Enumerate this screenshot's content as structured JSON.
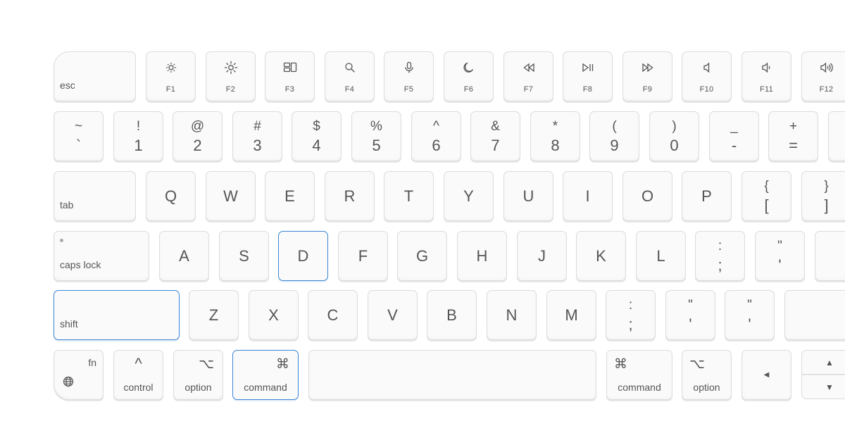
{
  "function_row": [
    {
      "id": "f1",
      "label": "F1",
      "icon": "brightness-low-icon"
    },
    {
      "id": "f2",
      "label": "F2",
      "icon": "brightness-high-icon"
    },
    {
      "id": "f3",
      "label": "F3",
      "icon": "mission-control-icon"
    },
    {
      "id": "f4",
      "label": "F4",
      "icon": "search-icon"
    },
    {
      "id": "f5",
      "label": "F5",
      "icon": "microphone-icon"
    },
    {
      "id": "f6",
      "label": "F6",
      "icon": "moon-icon"
    },
    {
      "id": "f7",
      "label": "F7",
      "icon": "rewind-icon"
    },
    {
      "id": "f8",
      "label": "F8",
      "icon": "play-pause-icon"
    },
    {
      "id": "f9",
      "label": "F9",
      "icon": "fast-forward-icon"
    },
    {
      "id": "f10",
      "label": "F10",
      "icon": "mute-icon"
    },
    {
      "id": "f11",
      "label": "F11",
      "icon": "volume-down-icon"
    },
    {
      "id": "f12",
      "label": "F12",
      "icon": "volume-up-icon"
    }
  ],
  "keys": {
    "esc": "esc",
    "tab": "tab",
    "caps_lock": "caps lock",
    "shift": "shift",
    "fn": "fn",
    "control": "control",
    "control_symbol": "^",
    "option": "option",
    "option_symbol": "⌥",
    "command": "command",
    "command_symbol": "⌘"
  },
  "number_row": [
    {
      "top": "~",
      "bottom": "`"
    },
    {
      "top": "!",
      "bottom": "1"
    },
    {
      "top": "@",
      "bottom": "2"
    },
    {
      "top": "#",
      "bottom": "3"
    },
    {
      "top": "$",
      "bottom": "4"
    },
    {
      "top": "%",
      "bottom": "5"
    },
    {
      "top": "^",
      "bottom": "6"
    },
    {
      "top": "&",
      "bottom": "7"
    },
    {
      "top": "*",
      "bottom": "8"
    },
    {
      "top": "(",
      "bottom": "9"
    },
    {
      "top": ")",
      "bottom": "0"
    },
    {
      "top": "_",
      "bottom": "-"
    },
    {
      "top": "+",
      "bottom": "="
    }
  ],
  "qwerty_row": [
    "Q",
    "W",
    "E",
    "R",
    "T",
    "Y",
    "U",
    "I",
    "O",
    "P"
  ],
  "qwerty_brackets": [
    {
      "top": "{",
      "bottom": "["
    },
    {
      "top": "}",
      "bottom": "]"
    }
  ],
  "home_row": [
    "A",
    "S",
    "D",
    "F",
    "G",
    "H",
    "J",
    "K",
    "L"
  ],
  "home_punct": [
    {
      "top": ":",
      "bottom": ";"
    },
    {
      "top": "\"",
      "bottom": "'"
    }
  ],
  "bottom_row": [
    "Z",
    "X",
    "C",
    "V",
    "B",
    "N",
    "M"
  ],
  "bottom_punct": [
    {
      "top": ":",
      "bottom": ";"
    },
    {
      "top": "\"",
      "bottom": "'"
    },
    {
      "top": "\"",
      "bottom": "'"
    }
  ],
  "arrows": {
    "left": "◀",
    "up": "▲",
    "down": "▼"
  },
  "highlighted": [
    "D",
    "shift",
    "command-left"
  ],
  "colors": {
    "highlight": "#3a86d6",
    "key_border": "#dcdcdc",
    "key_face": "#fafafa",
    "legend": "#555555"
  }
}
